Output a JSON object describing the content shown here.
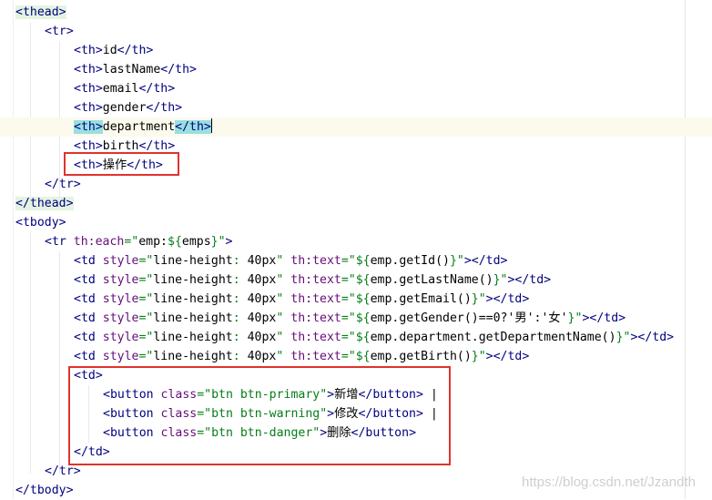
{
  "lines": [
    {
      "tokens": [
        {
          "c": "t",
          "v": "<thead>",
          "hl": "tag"
        }
      ]
    },
    {
      "tokens": [
        {
          "c": "t",
          "v": "<tr>"
        }
      ]
    },
    {
      "tokens": [
        {
          "c": "t",
          "v": "<th>"
        },
        {
          "c": "x",
          "v": "id"
        },
        {
          "c": "t",
          "v": "</th>"
        }
      ]
    },
    {
      "tokens": [
        {
          "c": "t",
          "v": "<th>"
        },
        {
          "c": "x",
          "v": "lastName"
        },
        {
          "c": "t",
          "v": "</th>"
        }
      ]
    },
    {
      "tokens": [
        {
          "c": "t",
          "v": "<th>"
        },
        {
          "c": "x",
          "v": "email"
        },
        {
          "c": "t",
          "v": "</th>"
        }
      ]
    },
    {
      "tokens": [
        {
          "c": "t",
          "v": "<th>"
        },
        {
          "c": "x",
          "v": "gender"
        },
        {
          "c": "t",
          "v": "</th>"
        }
      ]
    },
    {
      "tokens": [
        {
          "c": "t",
          "v": "<th>",
          "hl": "match"
        },
        {
          "c": "x",
          "v": "department"
        },
        {
          "c": "t",
          "v": "</th>",
          "hl": "match"
        }
      ]
    },
    {
      "tokens": [
        {
          "c": "t",
          "v": "<th>"
        },
        {
          "c": "x",
          "v": "birth"
        },
        {
          "c": "t",
          "v": "</th>"
        }
      ]
    },
    {
      "tokens": [
        {
          "c": "t",
          "v": "<th>"
        },
        {
          "c": "x",
          "v": "操作"
        },
        {
          "c": "t",
          "v": "</th>"
        }
      ]
    },
    {
      "tokens": [
        {
          "c": "t",
          "v": "</tr>"
        }
      ]
    },
    {
      "tokens": [
        {
          "c": "t",
          "v": "</thead>",
          "hl": "tag"
        }
      ]
    },
    {
      "tokens": [
        {
          "c": "t",
          "v": "<tbody>"
        }
      ]
    },
    {
      "tokens": [
        {
          "c": "t",
          "v": "<tr "
        },
        {
          "c": "ta",
          "v": "th:each"
        },
        {
          "c": "s",
          "v": "=\""
        },
        {
          "c": "x",
          "v": "emp:"
        },
        {
          "c": "s",
          "v": "${"
        },
        {
          "c": "x",
          "v": "emps"
        },
        {
          "c": "s",
          "v": "}\""
        },
        {
          "c": "t",
          "v": ">"
        }
      ]
    },
    {
      "tokens": [
        {
          "c": "t",
          "v": "<td "
        },
        {
          "c": "ta",
          "v": "style"
        },
        {
          "c": "s",
          "v": "=\""
        },
        {
          "c": "x",
          "v": "line-height"
        },
        {
          "c": "s",
          "v": ": "
        },
        {
          "c": "x",
          "v": "40px"
        },
        {
          "c": "s",
          "v": "\" "
        },
        {
          "c": "ta",
          "v": "th:text"
        },
        {
          "c": "s",
          "v": "=\""
        },
        {
          "c": "s",
          "v": "${"
        },
        {
          "c": "x",
          "v": "emp.getId()"
        },
        {
          "c": "s",
          "v": "}\""
        },
        {
          "c": "t",
          "v": "></td>"
        }
      ]
    },
    {
      "tokens": [
        {
          "c": "t",
          "v": "<td "
        },
        {
          "c": "ta",
          "v": "style"
        },
        {
          "c": "s",
          "v": "=\""
        },
        {
          "c": "x",
          "v": "line-height"
        },
        {
          "c": "s",
          "v": ": "
        },
        {
          "c": "x",
          "v": "40px"
        },
        {
          "c": "s",
          "v": "\" "
        },
        {
          "c": "ta",
          "v": "th:text"
        },
        {
          "c": "s",
          "v": "=\""
        },
        {
          "c": "s",
          "v": "${"
        },
        {
          "c": "x",
          "v": "emp.getLastName()"
        },
        {
          "c": "s",
          "v": "}\""
        },
        {
          "c": "t",
          "v": "></td>"
        }
      ]
    },
    {
      "tokens": [
        {
          "c": "t",
          "v": "<td "
        },
        {
          "c": "ta",
          "v": "style"
        },
        {
          "c": "s",
          "v": "=\""
        },
        {
          "c": "x",
          "v": "line-height"
        },
        {
          "c": "s",
          "v": ": "
        },
        {
          "c": "x",
          "v": "40px"
        },
        {
          "c": "s",
          "v": "\" "
        },
        {
          "c": "ta",
          "v": "th:text"
        },
        {
          "c": "s",
          "v": "=\""
        },
        {
          "c": "s",
          "v": "${"
        },
        {
          "c": "x",
          "v": "emp.getEmail()"
        },
        {
          "c": "s",
          "v": "}\""
        },
        {
          "c": "t",
          "v": "></td>"
        }
      ]
    },
    {
      "tokens": [
        {
          "c": "t",
          "v": "<td "
        },
        {
          "c": "ta",
          "v": "style"
        },
        {
          "c": "s",
          "v": "=\""
        },
        {
          "c": "x",
          "v": "line-height"
        },
        {
          "c": "s",
          "v": ": "
        },
        {
          "c": "x",
          "v": "40px"
        },
        {
          "c": "s",
          "v": "\" "
        },
        {
          "c": "ta",
          "v": "th:text"
        },
        {
          "c": "s",
          "v": "=\""
        },
        {
          "c": "s",
          "v": "${"
        },
        {
          "c": "x",
          "v": "emp.getGender()==0?'男':'女'"
        },
        {
          "c": "s",
          "v": "}\""
        },
        {
          "c": "t",
          "v": "></td>"
        }
      ]
    },
    {
      "tokens": [
        {
          "c": "t",
          "v": "<td "
        },
        {
          "c": "ta",
          "v": "style"
        },
        {
          "c": "s",
          "v": "=\""
        },
        {
          "c": "x",
          "v": "line-height"
        },
        {
          "c": "s",
          "v": ": "
        },
        {
          "c": "x",
          "v": "40px"
        },
        {
          "c": "s",
          "v": "\" "
        },
        {
          "c": "ta",
          "v": "th:text"
        },
        {
          "c": "s",
          "v": "=\""
        },
        {
          "c": "s",
          "v": "${"
        },
        {
          "c": "x",
          "v": "emp.department.getDepartmentName()"
        },
        {
          "c": "s",
          "v": "}\""
        },
        {
          "c": "t",
          "v": "></td>"
        }
      ]
    },
    {
      "tokens": [
        {
          "c": "t",
          "v": "<td "
        },
        {
          "c": "ta",
          "v": "style"
        },
        {
          "c": "s",
          "v": "=\""
        },
        {
          "c": "x",
          "v": "line-height"
        },
        {
          "c": "s",
          "v": ": "
        },
        {
          "c": "x",
          "v": "40px"
        },
        {
          "c": "s",
          "v": "\" "
        },
        {
          "c": "ta",
          "v": "th:text"
        },
        {
          "c": "s",
          "v": "=\""
        },
        {
          "c": "s",
          "v": "${"
        },
        {
          "c": "x",
          "v": "emp.getBirth()"
        },
        {
          "c": "s",
          "v": "}\""
        },
        {
          "c": "t",
          "v": "></td>"
        }
      ]
    },
    {
      "tokens": [
        {
          "c": "t",
          "v": "<td>"
        }
      ]
    },
    {
      "tokens": [
        {
          "c": "t",
          "v": "<button "
        },
        {
          "c": "ta",
          "v": "class"
        },
        {
          "c": "s",
          "v": "=\"btn btn-primary\""
        },
        {
          "c": "t",
          "v": ">"
        },
        {
          "c": "x",
          "v": "新增"
        },
        {
          "c": "t",
          "v": "</button>"
        },
        {
          "c": "x",
          "v": " |"
        }
      ]
    },
    {
      "tokens": [
        {
          "c": "t",
          "v": "<button "
        },
        {
          "c": "ta",
          "v": "class"
        },
        {
          "c": "s",
          "v": "=\"btn btn-warning\""
        },
        {
          "c": "t",
          "v": ">"
        },
        {
          "c": "x",
          "v": "修改"
        },
        {
          "c": "t",
          "v": "</button>"
        },
        {
          "c": "x",
          "v": " |"
        }
      ]
    },
    {
      "tokens": [
        {
          "c": "t",
          "v": "<button "
        },
        {
          "c": "ta",
          "v": "class"
        },
        {
          "c": "s",
          "v": "=\"btn btn-danger\""
        },
        {
          "c": "t",
          "v": ">"
        },
        {
          "c": "x",
          "v": "删除"
        },
        {
          "c": "t",
          "v": "</button>"
        }
      ]
    },
    {
      "tokens": [
        {
          "c": "t",
          "v": "</td>"
        }
      ]
    },
    {
      "tokens": [
        {
          "c": "t",
          "v": "</tr>"
        }
      ]
    },
    {
      "tokens": [
        {
          "c": "t",
          "v": "</tbody>"
        }
      ]
    }
  ],
  "watermark": "https://blog.csdn.net/Jzandth",
  "colors": {
    "tag": "#000080",
    "attribute": "#660e7a",
    "string": "#067d17",
    "highlight_box": "#e0332e"
  }
}
